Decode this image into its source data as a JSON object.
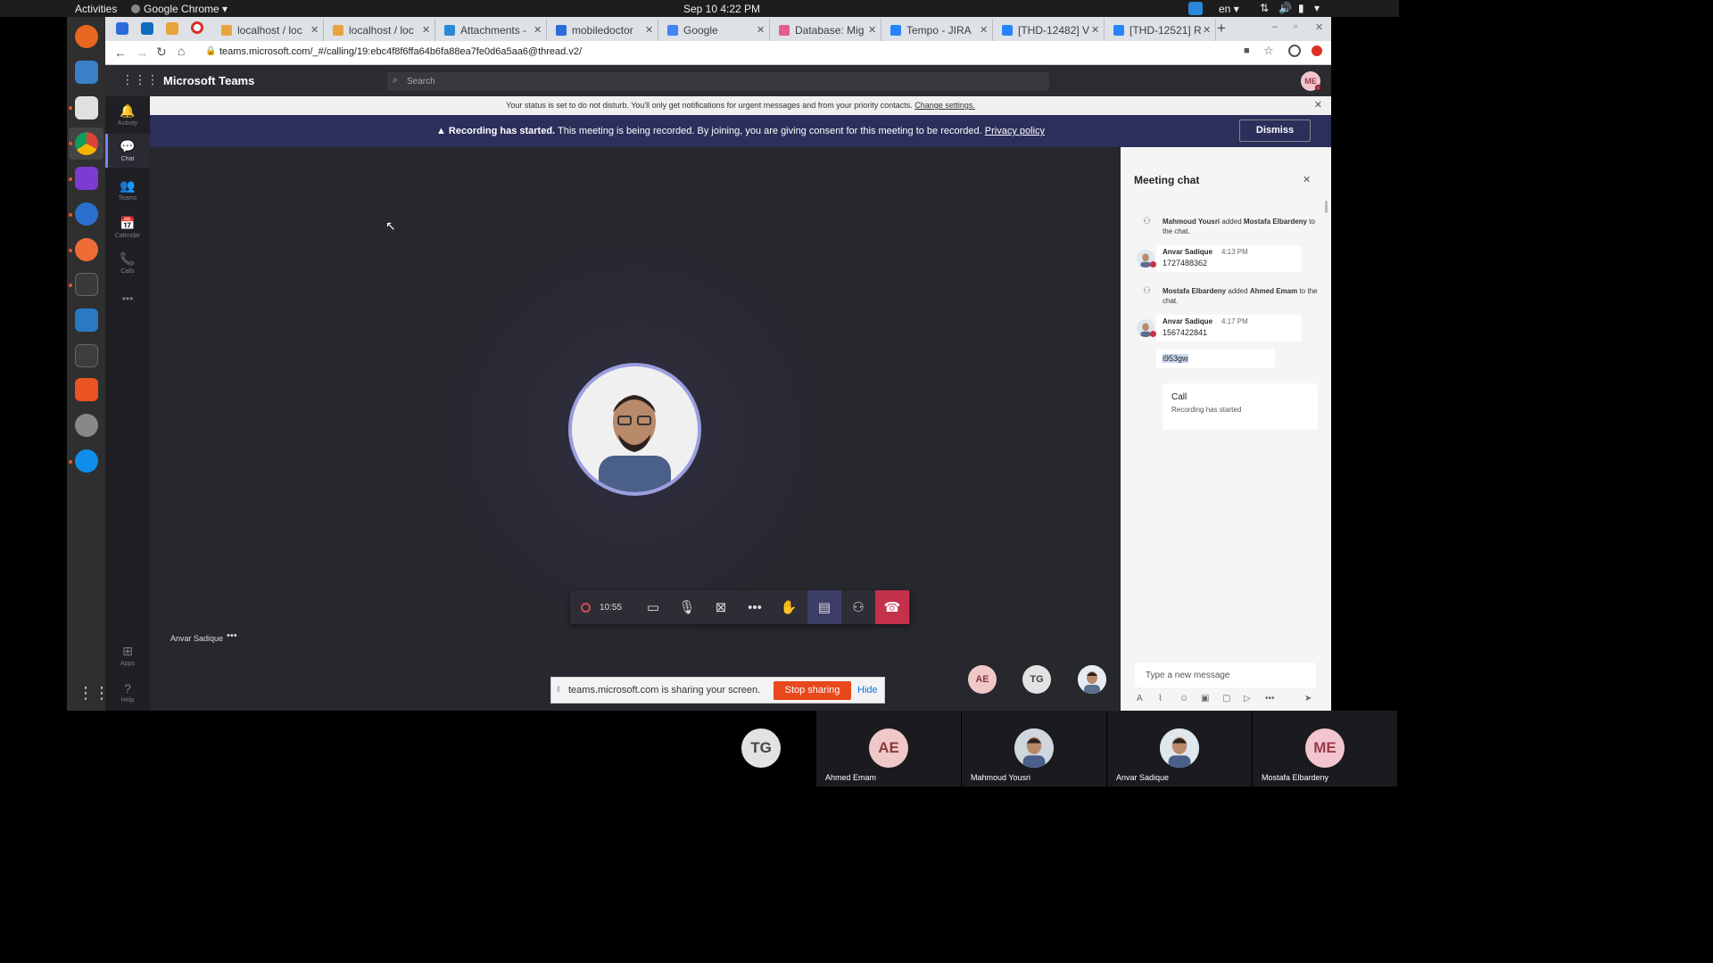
{
  "topbar": {
    "activities": "Activities",
    "app_menu": "Google Chrome",
    "clock": "Sep 10  4:22 PM",
    "lang": "en"
  },
  "tabs": [
    {
      "label": "localhost / loc",
      "color": "#e8a33d"
    },
    {
      "label": "localhost / loc",
      "color": "#e8a33d"
    },
    {
      "label": "Attachments -",
      "color": "#2b88d8"
    },
    {
      "label": "mobiledoctor",
      "color": "#2b6cd8"
    },
    {
      "label": "Google",
      "color": "#4285f4"
    },
    {
      "label": "Database: Mig",
      "color": "#e25d8a"
    },
    {
      "label": "Tempo - JIRA",
      "color": "#2684ff"
    },
    {
      "label": "[THD-12482] V",
      "color": "#2684ff"
    },
    {
      "label": "[THD-12521] R",
      "color": "#2684ff"
    }
  ],
  "address": {
    "url": "teams.microsoft.com/_#/calling/19:ebc4f8f6ffa64b6fa88ea7fe0d6a5aa6@thread.v2/"
  },
  "teams": {
    "title": "Microsoft Teams",
    "search_placeholder": "Search",
    "me_initials": "ME"
  },
  "rail": [
    {
      "label": "Activity",
      "icon": "bell-icon",
      "glyph": "🔔"
    },
    {
      "label": "Chat",
      "icon": "chat-icon",
      "glyph": "💬"
    },
    {
      "label": "Teams",
      "icon": "teams-icon",
      "glyph": "👥"
    },
    {
      "label": "Calendar",
      "icon": "calendar-icon",
      "glyph": "📅"
    },
    {
      "label": "Calls",
      "icon": "phone-icon",
      "glyph": "📞"
    },
    {
      "label": "•••",
      "icon": "more-icon",
      "glyph": ""
    }
  ],
  "rail_bottom": [
    {
      "label": "Apps",
      "icon": "apps-icon",
      "glyph": "⊞"
    },
    {
      "label": "Help",
      "icon": "help-icon",
      "glyph": "?"
    }
  ],
  "status_banner": {
    "text": "Your status is set to do not disturb. You'll only get notifications for urgent messages and from your priority contacts.",
    "link": "Change settings."
  },
  "recording_banner": {
    "bold": "Recording has started.",
    "text": "This meeting is being recorded. By joining, you are giving consent for this meeting to be recorded.",
    "link": "Privacy policy",
    "dismiss": "Dismiss"
  },
  "stage": {
    "speaker_name": "Anvar Sadique",
    "timer": "10:55"
  },
  "share_bar": {
    "text": "teams.microsoft.com is sharing your screen.",
    "stop": "Stop sharing",
    "hide": "Hide"
  },
  "participants_small": [
    {
      "initials": "AE",
      "bg": "#f0c8c8",
      "fg": "#8a3a3a"
    },
    {
      "initials": "TG",
      "bg": "#e2e2e2",
      "fg": "#444"
    }
  ],
  "chat": {
    "title": "Meeting chat",
    "sys1_a": "Mahmoud Yousri",
    "sys1_b": "added",
    "sys1_c": "Mostafa Elbardeny",
    "sys1_d": "to the chat.",
    "m1_name": "Anvar Sadique",
    "m1_time": "4:13 PM",
    "m1_text": "1727488362",
    "sys2_a": "Mostafa Elbardeny",
    "sys2_b": "added",
    "sys2_c": "Ahmed Emam",
    "sys2_d": "to the chat.",
    "m2_name": "Anvar Sadique",
    "m2_time": "4:17 PM",
    "m2_text": "1567422841",
    "m3_text": "i953gw",
    "call_title": "Call",
    "call_sub": "Recording has started",
    "compose_placeholder": "Type a new message"
  },
  "bottom_tiles": [
    {
      "name": "",
      "initials": "TG",
      "bg": "#e2e2e2",
      "fg": "#444",
      "photo": false
    },
    {
      "name": "Ahmed Emam",
      "initials": "AE",
      "bg": "#f0c8c8",
      "fg": "#8a3a3a",
      "photo": false
    },
    {
      "name": "Mahmoud Yousri",
      "initials": "",
      "bg": "#cfd6dd",
      "fg": "#333",
      "photo": true
    },
    {
      "name": "Anvar Sadique",
      "initials": "",
      "bg": "#dfe6ec",
      "fg": "#333",
      "photo": true
    },
    {
      "name": "Mostafa Elbardeny",
      "initials": "ME",
      "bg": "#f3c6cf",
      "fg": "#9b3a4c",
      "photo": false
    }
  ]
}
